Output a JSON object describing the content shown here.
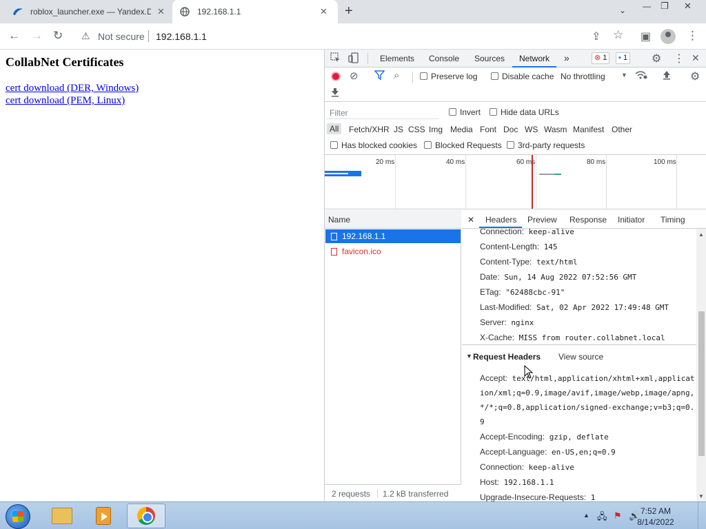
{
  "browser": {
    "tabs": [
      {
        "title": "roblox_launcher.exe — Yandex.Di",
        "close": "✕"
      },
      {
        "title": "192.168.1.1",
        "close": "✕"
      }
    ],
    "new_tab": "+",
    "window_controls": {
      "minimize": "—",
      "restore": "❐",
      "close": "✕"
    },
    "tab_search": "⌄",
    "nav": {
      "back": "←",
      "forward": "→",
      "reload": "↻"
    },
    "omnibox": {
      "security_icon": "⚠",
      "security_text": "Not secure",
      "url": "192.168.1.1"
    },
    "toolbar_icons": {
      "share": "⇪",
      "bookmark": "☆",
      "sidepanel": "▣",
      "menu": "⋮"
    }
  },
  "page": {
    "heading": "CollabNet Certificates",
    "links": [
      "cert download (DER, Windows)",
      "cert download (PEM, Linux)"
    ]
  },
  "devtools": {
    "tabs": [
      "Elements",
      "Console",
      "Sources",
      "Network"
    ],
    "more_tabs": "»",
    "error_count": "1",
    "message_count": "1",
    "top_icons": {
      "settings": "⚙",
      "more": "⋮",
      "close": "✕"
    },
    "toolbar": {
      "preserve_log": "Preserve log",
      "disable_cache": "Disable cache",
      "throttling": "No throttling",
      "throttle_arrow": "▼"
    },
    "filter": {
      "placeholder": "Filter",
      "invert": "Invert",
      "hide_data_urls": "Hide data URLs",
      "types": [
        "All",
        "Fetch/XHR",
        "JS",
        "CSS",
        "Img",
        "Media",
        "Font",
        "Doc",
        "WS",
        "Wasm",
        "Manifest",
        "Other"
      ],
      "has_blocked_cookies": "Has blocked cookies",
      "blocked_requests": "Blocked Requests",
      "third_party": "3rd-party requests"
    },
    "timeline_ticks": [
      "20 ms",
      "40 ms",
      "60 ms",
      "80 ms",
      "100 ms"
    ],
    "request_list": {
      "header": "Name",
      "rows": [
        {
          "name": "192.168.1.1",
          "selected": true
        },
        {
          "name": "favicon.ico",
          "error": true
        }
      ],
      "footer": {
        "requests": "2 requests",
        "transferred": "1.2 kB transferred"
      }
    },
    "detail": {
      "close": "✕",
      "tabs": [
        "Headers",
        "Preview",
        "Response",
        "Initiator",
        "Timing"
      ],
      "response_headers": [
        {
          "key": "Connection:",
          "value": "keep-alive"
        },
        {
          "key": "Content-Length:",
          "value": "145"
        },
        {
          "key": "Content-Type:",
          "value": "text/html"
        },
        {
          "key": "Date:",
          "value": "Sun, 14 Aug 2022 07:52:56 GMT"
        },
        {
          "key": "ETag:",
          "value": "\"62488cbc-91\""
        },
        {
          "key": "Last-Modified:",
          "value": "Sat, 02 Apr 2022 17:49:48 GMT"
        },
        {
          "key": "Server:",
          "value": "nginx"
        },
        {
          "key": "X-Cache:",
          "value": "MISS from router.collabnet.local"
        }
      ],
      "request_headers_title": "Request Headers",
      "view_source": "View source",
      "request_headers": [
        {
          "key": "Accept:",
          "value": "text/html,application/xhtml+xml,application/xml;q=0.9,image/avif,image/webp,image/apng,*/*;q=0.8,application/signed-exchange;v=b3;q=0.9"
        },
        {
          "key": "Accept-Encoding:",
          "value": "gzip, deflate"
        },
        {
          "key": "Accept-Language:",
          "value": "en-US,en;q=0.9"
        },
        {
          "key": "Connection:",
          "value": "keep-alive"
        },
        {
          "key": "Host:",
          "value": "192.168.1.1"
        },
        {
          "key": "Upgrade-Insecure-Requests:",
          "value": "1"
        }
      ]
    }
  },
  "taskbar": {
    "clock_time": "7:52 AM",
    "clock_date": "8/14/2022",
    "tray": {
      "arrow": "▲",
      "network": "🖧",
      "flag": "⚑",
      "volume": "🔊"
    }
  },
  "colors": {
    "accent": "#1a73e8",
    "error": "#d93025",
    "record": "#e8183a"
  }
}
